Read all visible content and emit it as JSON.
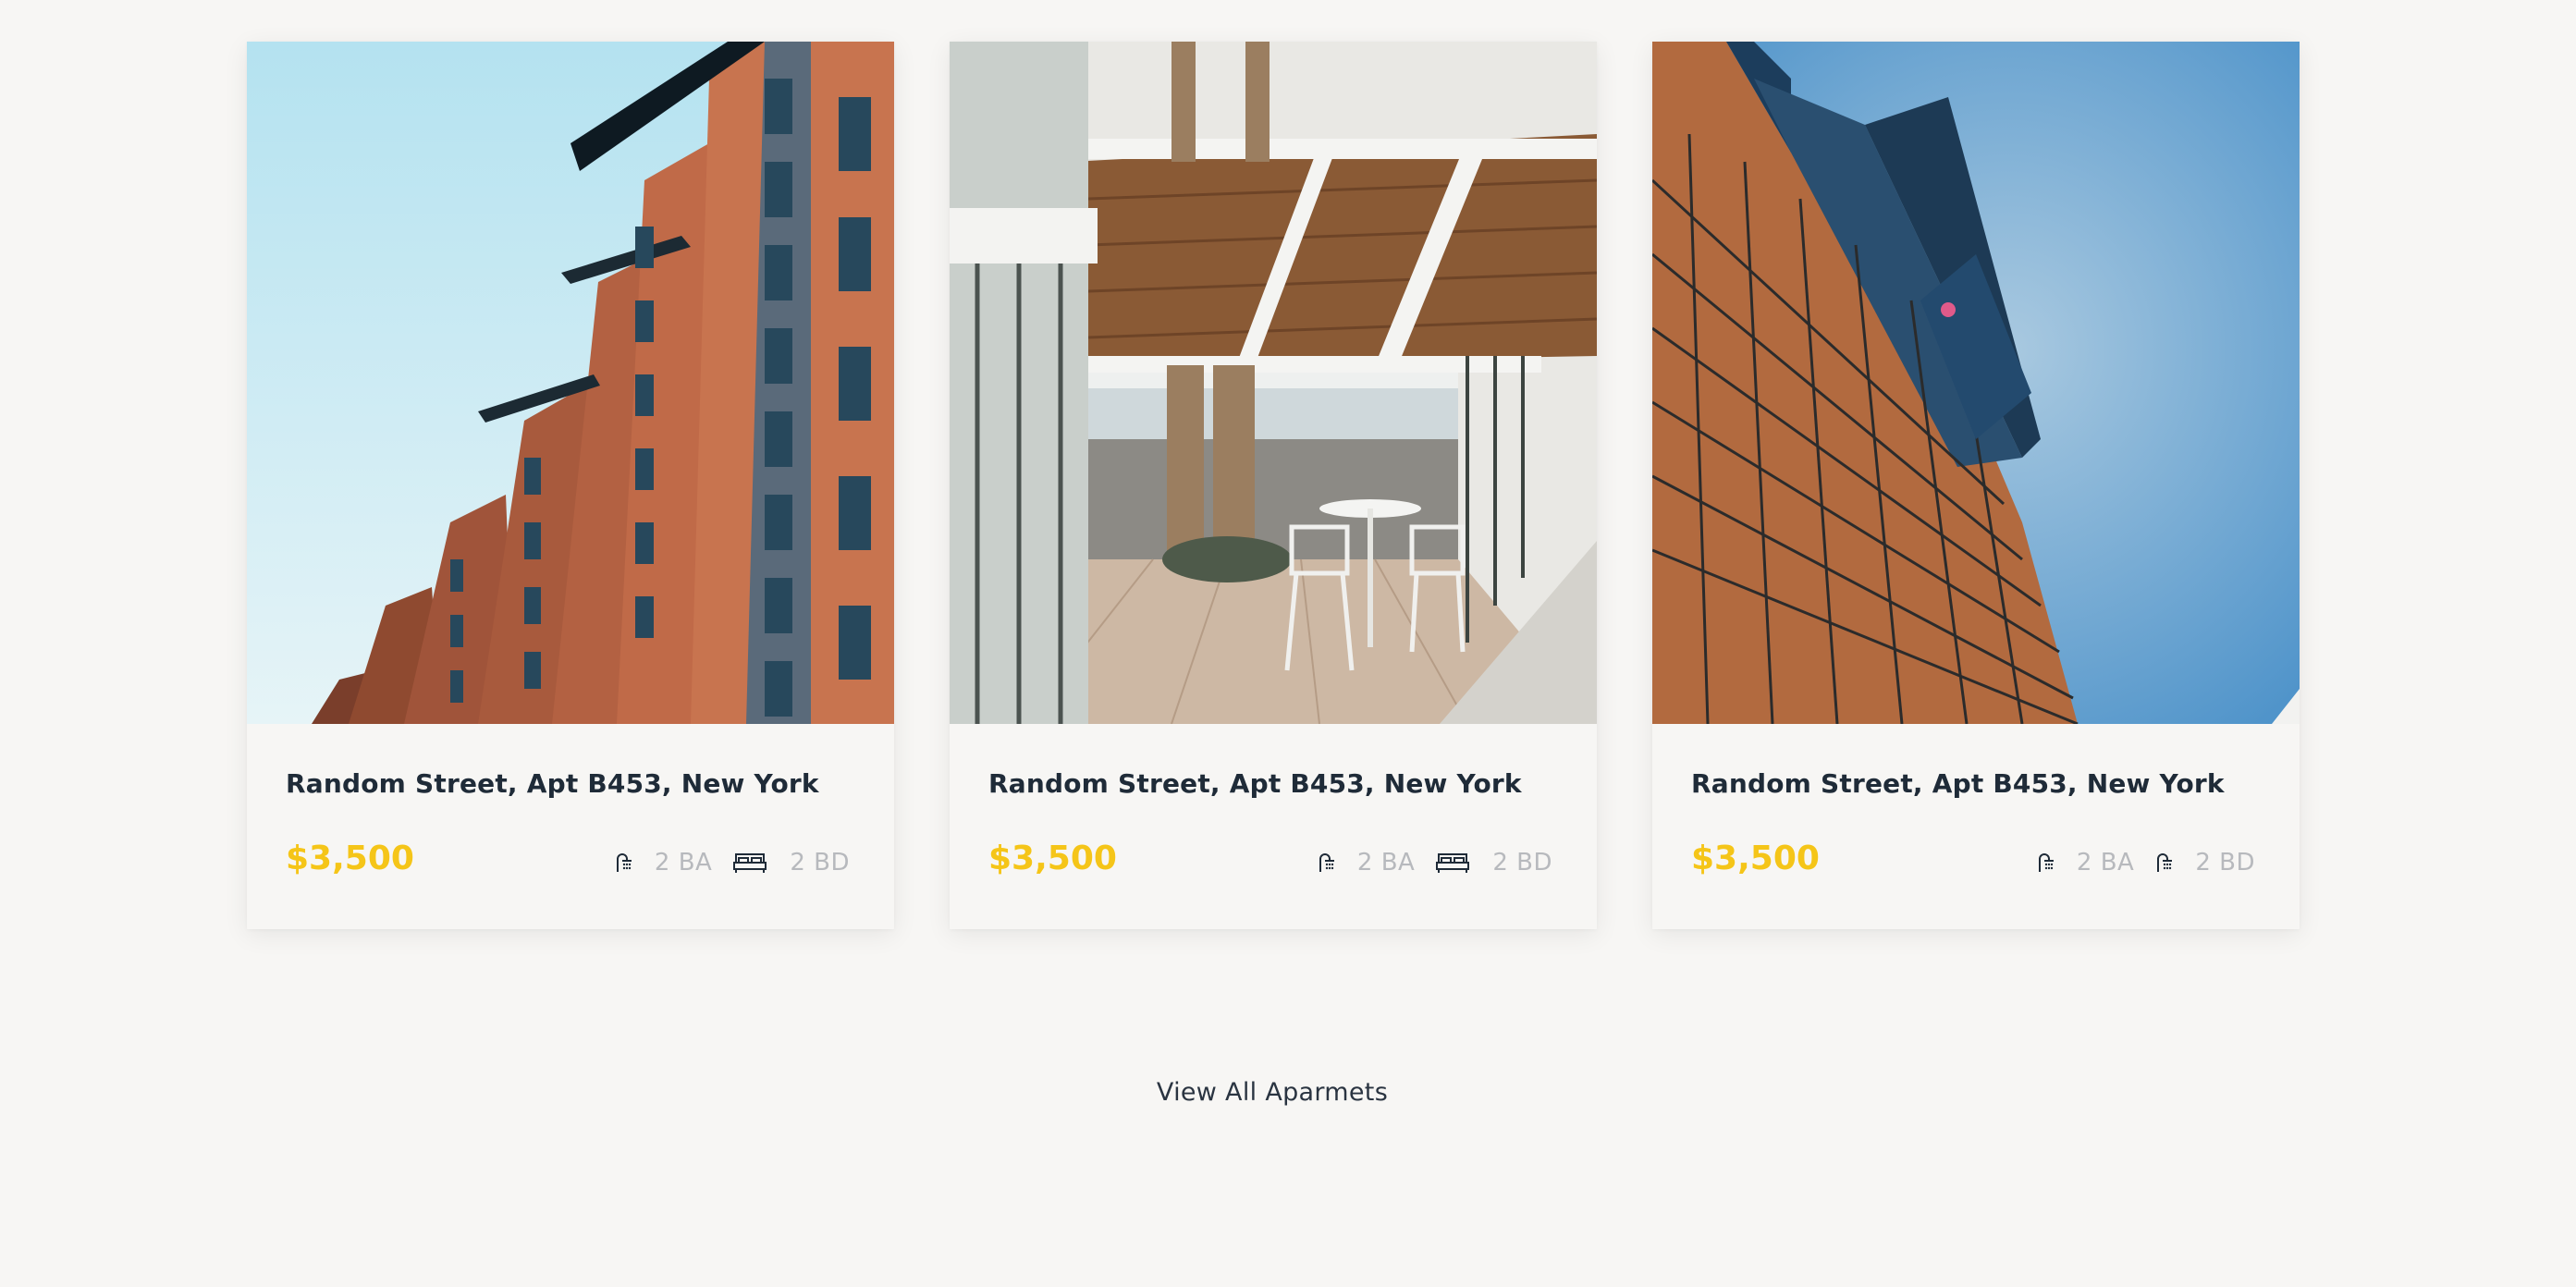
{
  "listings": [
    {
      "title": "Random Street, Apt B453, New York",
      "price": "$3,500",
      "baths": "2 BA",
      "beds": "2 BD",
      "bath_icon": "shower-icon",
      "bed_icon": "bed-icon",
      "photo": "brick-apartment-building-photo"
    },
    {
      "title": "Random Street, Apt B453, New York",
      "price": "$3,500",
      "baths": "2 BA",
      "beds": "2 BD",
      "bath_icon": "shower-icon",
      "bed_icon": "bed-icon",
      "photo": "beachfront-terrace-photo"
    },
    {
      "title": "Random Street, Apt B453, New York",
      "price": "$3,500",
      "baths": "2 BA",
      "beds": "2 BD",
      "bath_icon": "shower-icon",
      "bed_icon": "shower-icon",
      "photo": "modern-tower-building-photo"
    }
  ],
  "view_all_label": "View All Aparmets",
  "colors": {
    "background": "#f7f6f4",
    "price": "#f5c518",
    "title": "#1f2b38",
    "spec_text": "#b7b9bd"
  }
}
